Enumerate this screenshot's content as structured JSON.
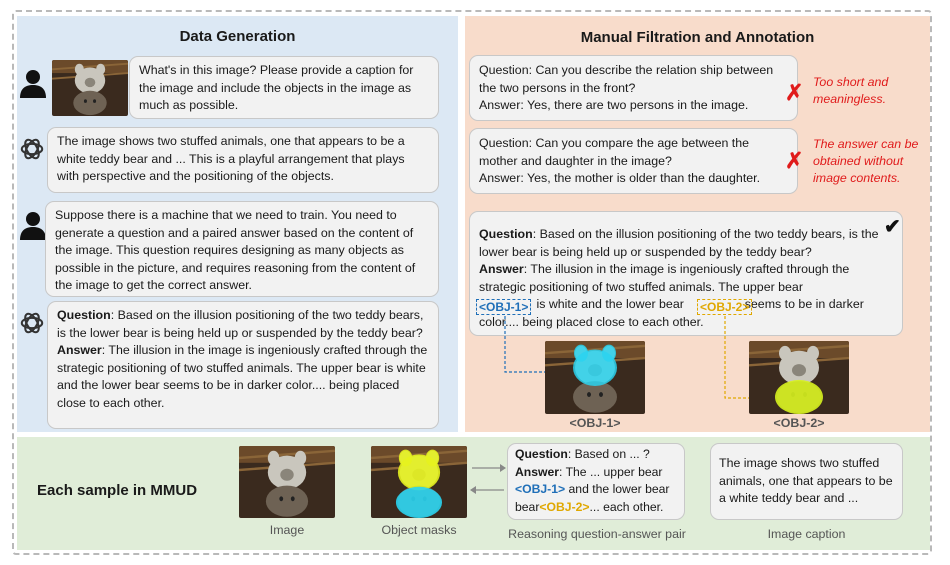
{
  "data_generation": {
    "title": "Data Generation",
    "prompt_caption": "What's in this image? Please provide a caption for the image and include the objects in the image as much as possible.",
    "response_caption": "The image shows two stuffed animals, one that appears to be a white teddy bear and ... This is a playful arrangement that plays with perspective and the positioning of the objects.",
    "prompt_qa": "Suppose there is a machine that we need to train. You need to generate a question and a paired answer based on the content of the image. This question requires designing as many objects as possible in the picture, and requires reasoning from the content of the image to get the correct answer.",
    "qa_question_label": "Question",
    "qa_question": ": Based on the illusion positioning of the two teddy bears, is the lower bear is being held up or suspended by the teddy bear?",
    "qa_answer_label": "Answer",
    "qa_answer": ": The illusion in the image is ingeniously crafted through the strategic positioning of two stuffed animals. The upper bear is white and the lower bear seems to be in darker color.... being placed close to each other."
  },
  "filtration": {
    "title": "Manual Filtration and Annotation",
    "rejected_1": {
      "question": "Question: Can you describe the relation ship between the two persons in the front?",
      "answer": "Answer: Yes, there are two persons in the image.",
      "reason": "Too short and meaningless."
    },
    "rejected_2": {
      "question": "Question: Can you compare the age between the mother and daughter in the image?",
      "answer": "Answer: Yes, the mother is older than the daughter.",
      "reason": "The answer can be obtained without image contents."
    },
    "accepted": {
      "question_label": "Question",
      "question": ": Based on the illusion positioning of the two teddy bears, is the lower bear is being held up or suspended by the teddy bear?",
      "answer_label": "Answer",
      "answer_part1": ": The illusion in the image is ingeniously crafted through the strategic positioning of two stuffed animals. The upper bear",
      "obj1": "<OBJ-1>",
      "answer_part2": " is white and the lower bear ",
      "obj2": "<OBJ-2>",
      "answer_part3": " seems to be in darker color.... being placed close to each other."
    },
    "obj1_label": "<OBJ-1>",
    "obj2_label": "<OBJ-2>"
  },
  "sample": {
    "title": "Each sample in MMUD",
    "image_label": "Image",
    "masks_label": "Object masks",
    "qa_label": "Reasoning question-answer pair",
    "caption_label": "Image caption",
    "qa_q_label": "Question",
    "qa_q": ": Based on ... ?",
    "qa_a_label": "Answer",
    "qa_a1": ": The ... upper bear ",
    "qa_obj1": "<OBJ-1>",
    "qa_a2": " and the lower bear",
    "qa_obj2": "<OBJ-2>",
    "qa_a3": "... each other.",
    "caption_text": "The image shows two stuffed animals, one that appears to be a white teddy bear and ..."
  },
  "colors": {
    "blue": "#1f6fb8",
    "gold": "#e0a800",
    "red": "#e01b1b",
    "mask_cyan": "#2ad4f0",
    "mask_yellow": "#e6f21e"
  }
}
